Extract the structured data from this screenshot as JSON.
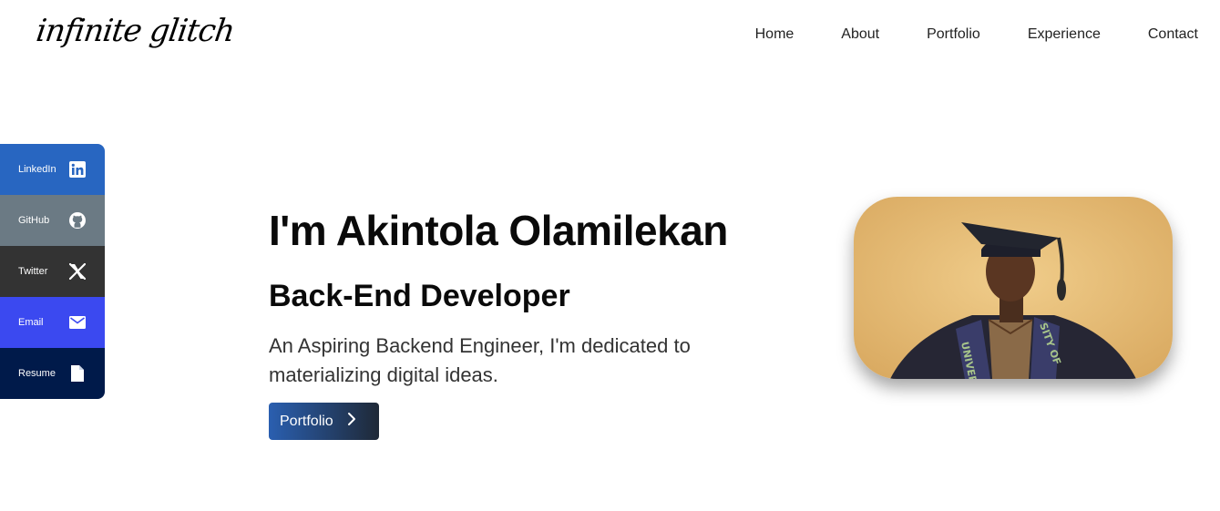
{
  "header": {
    "logo": "infinite glitch",
    "nav": [
      "Home",
      "About",
      "Portfolio",
      "Experience",
      "Contact"
    ]
  },
  "social": [
    {
      "label": "LinkedIn",
      "icon": "linkedin-icon",
      "color": "#2866c1"
    },
    {
      "label": "GitHub",
      "icon": "github-icon",
      "color": "#6b7a84"
    },
    {
      "label": "Twitter",
      "icon": "x-icon",
      "color": "#333333"
    },
    {
      "label": "Email",
      "icon": "email-icon",
      "color": "#3b49f0"
    },
    {
      "label": "Resume",
      "icon": "file-icon",
      "color": "#001a4a"
    }
  ],
  "hero": {
    "title": "I'm Akintola Olamilekan",
    "role": "Back-End Developer",
    "description": "An Aspiring Backend Engineer, I'm dedicated to materializing digital ideas.",
    "cta_label": "Portfolio"
  },
  "photo": {
    "sash_text": "UNIVERSITY OF"
  }
}
